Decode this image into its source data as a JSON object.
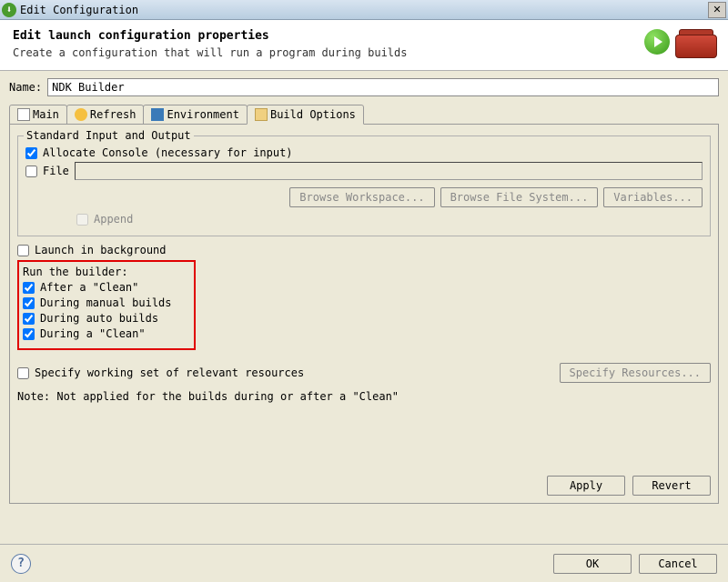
{
  "window": {
    "title": "Edit Configuration"
  },
  "header": {
    "title": "Edit launch configuration properties",
    "subtitle": "Create a configuration that will run a program during builds"
  },
  "name": {
    "label": "Name:",
    "value": "NDK Builder"
  },
  "tabs": {
    "main": "Main",
    "refresh": "Refresh",
    "environment": "Environment",
    "build_options": "Build Options"
  },
  "stdio": {
    "legend": "Standard Input and Output",
    "allocate_console": "Allocate Console (necessary for input)",
    "file": "File",
    "append": "Append",
    "browse_workspace": "Browse Workspace...",
    "browse_fs": "Browse File System...",
    "variables": "Variables..."
  },
  "launch_bg": "Launch in background",
  "run_builder": {
    "legend": "Run the builder:",
    "after_clean": "After a \"Clean\"",
    "during_manual": "During manual builds",
    "during_auto": "During auto builds",
    "during_clean": "During a \"Clean\""
  },
  "specify_ws": {
    "label": "Specify working set of relevant resources",
    "button": "Specify Resources..."
  },
  "note": "Note: Not applied for the builds during or after a \"Clean\"",
  "buttons": {
    "apply": "Apply",
    "revert": "Revert",
    "ok": "OK",
    "cancel": "Cancel"
  }
}
